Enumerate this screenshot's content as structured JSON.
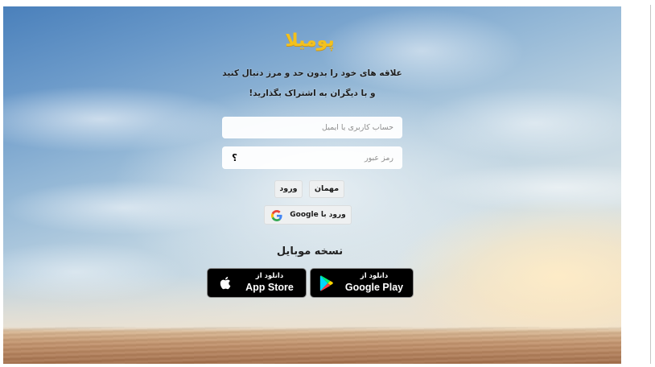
{
  "brand": {
    "logo_text": "پومیلا",
    "logo_color": "#f3c11d"
  },
  "tagline": {
    "line1": "علاقه های خود را بدون حد و مرز دنبال کنید",
    "line2": "و با دیگران به اشتراک بگذارید!"
  },
  "login_form": {
    "username_placeholder": "حساب کاربری یا ایمیل",
    "password_placeholder": "رمز عبور",
    "forgot_password_symbol": "؟",
    "login_label": "ورود",
    "guest_label": "مهمان",
    "google_login_label": "ورود با Google",
    "google_icon": "google-g-icon"
  },
  "mobile": {
    "heading": "نسخه موبایل",
    "app_store": {
      "caption": "دانلود از",
      "store": "App Store",
      "icon": "apple-icon"
    },
    "google_play": {
      "caption": "دانلود از",
      "store": "Google Play",
      "icon": "google-play-icon"
    }
  },
  "colors": {
    "badge_background": "#000000",
    "badge_text": "#ffffff"
  }
}
